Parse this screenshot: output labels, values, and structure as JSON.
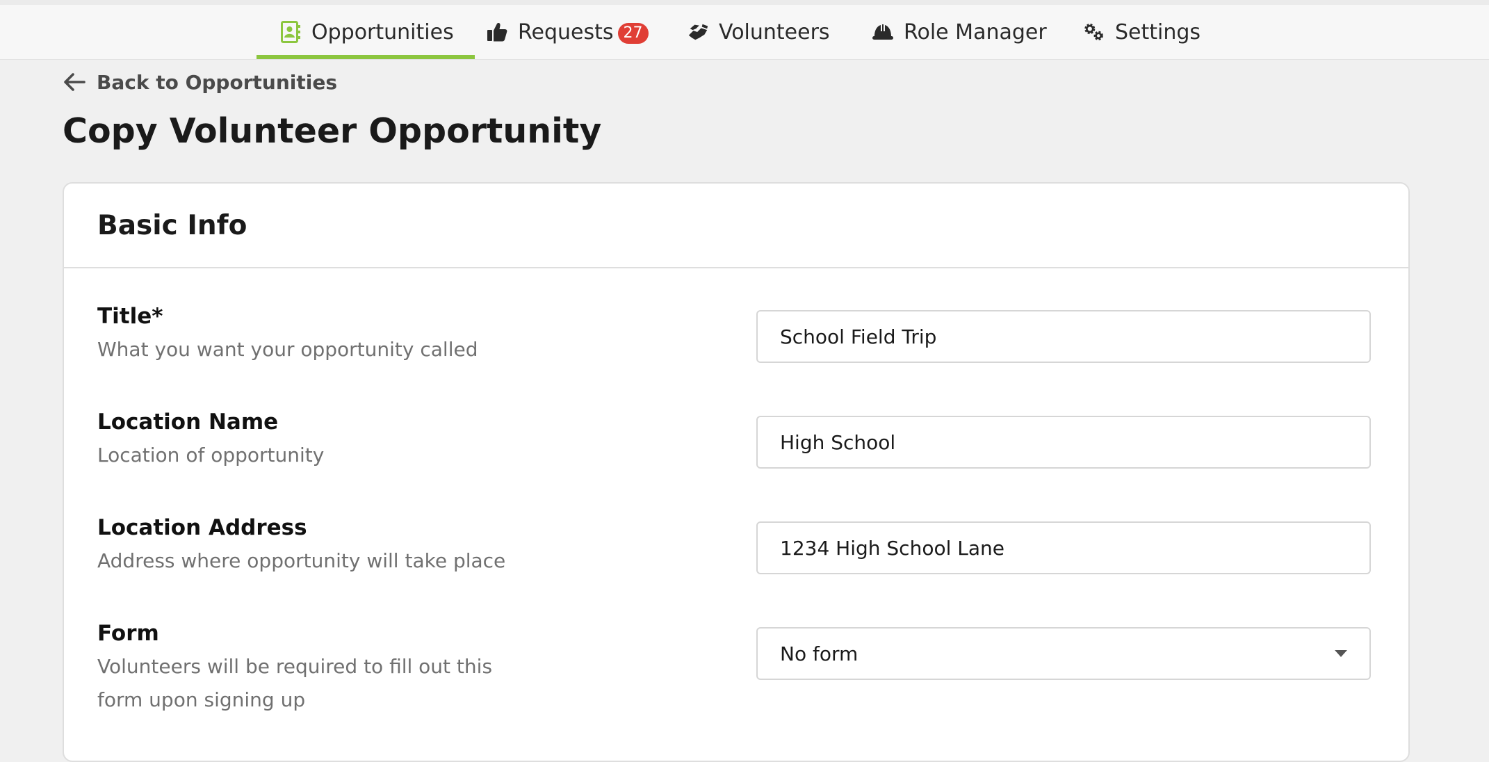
{
  "nav": {
    "tabs": [
      {
        "label": "Opportunities",
        "icon": "contact-card-icon",
        "active": true
      },
      {
        "label": "Requests",
        "icon": "thumbs-up-icon",
        "badge": "27"
      },
      {
        "label": "Volunteers",
        "icon": "handshake-icon"
      },
      {
        "label": "Role Manager",
        "icon": "hard-hat-icon"
      },
      {
        "label": "Settings",
        "icon": "gears-icon"
      }
    ]
  },
  "back_link": "Back to Opportunities",
  "page_title": "Copy Volunteer Opportunity",
  "card": {
    "title": "Basic Info",
    "fields": {
      "title": {
        "label": "Title*",
        "help": "What you want your opportunity called",
        "value": "School Field Trip"
      },
      "location_name": {
        "label": "Location Name",
        "help": "Location of opportunity",
        "value": "High School"
      },
      "location_address": {
        "label": "Location Address",
        "help": "Address where opportunity will take place",
        "value": "1234 High School Lane"
      },
      "form": {
        "label": "Form",
        "help": "Volunteers will be required to fill out this form upon signing up",
        "value": "No form"
      }
    }
  },
  "colors": {
    "accent": "#8cc63f",
    "badge": "#e03e35",
    "background": "#f0f0f0"
  }
}
